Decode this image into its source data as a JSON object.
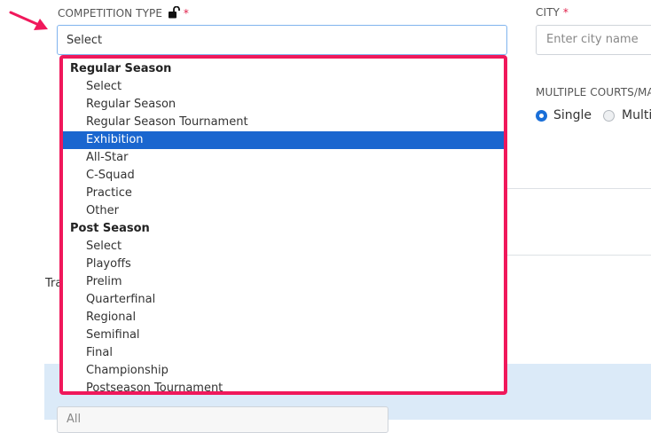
{
  "competition_type": {
    "label": "COMPETITION TYPE",
    "required_mark": "*",
    "selected_value": "Select",
    "icons": {
      "lock": "unlock-icon",
      "pointer": "arrow-pointer-icon"
    }
  },
  "city": {
    "label": "CITY",
    "required_mark": "*",
    "placeholder": "Enter city name"
  },
  "multiple_courts": {
    "label": "MULTIPLE COURTS/MATS",
    "options": [
      {
        "label": "Single",
        "checked": true
      },
      {
        "label": "Multi",
        "checked": false
      }
    ]
  },
  "partial_text": {
    "left_label": "Tra",
    "bottom_value": "All"
  },
  "dropdown": {
    "groups": [
      {
        "label": "Regular Season",
        "options": [
          "Select",
          "Regular Season",
          "Regular Season Tournament",
          "Exhibition",
          "All-Star",
          "C-Squad",
          "Practice",
          "Other"
        ]
      },
      {
        "label": "Post Season",
        "options": [
          "Select",
          "Playoffs",
          "Prelim",
          "Quarterfinal",
          "Regional",
          "Semifinal",
          "Final",
          "Championship",
          "Postseason Tournament"
        ]
      }
    ],
    "highlighted": "Exhibition"
  },
  "colors": {
    "accent_pink": "#f0185b",
    "highlight_blue": "#1a66cf",
    "radio_blue": "#1a6fd8",
    "panel_blue": "#dbeaf8"
  }
}
